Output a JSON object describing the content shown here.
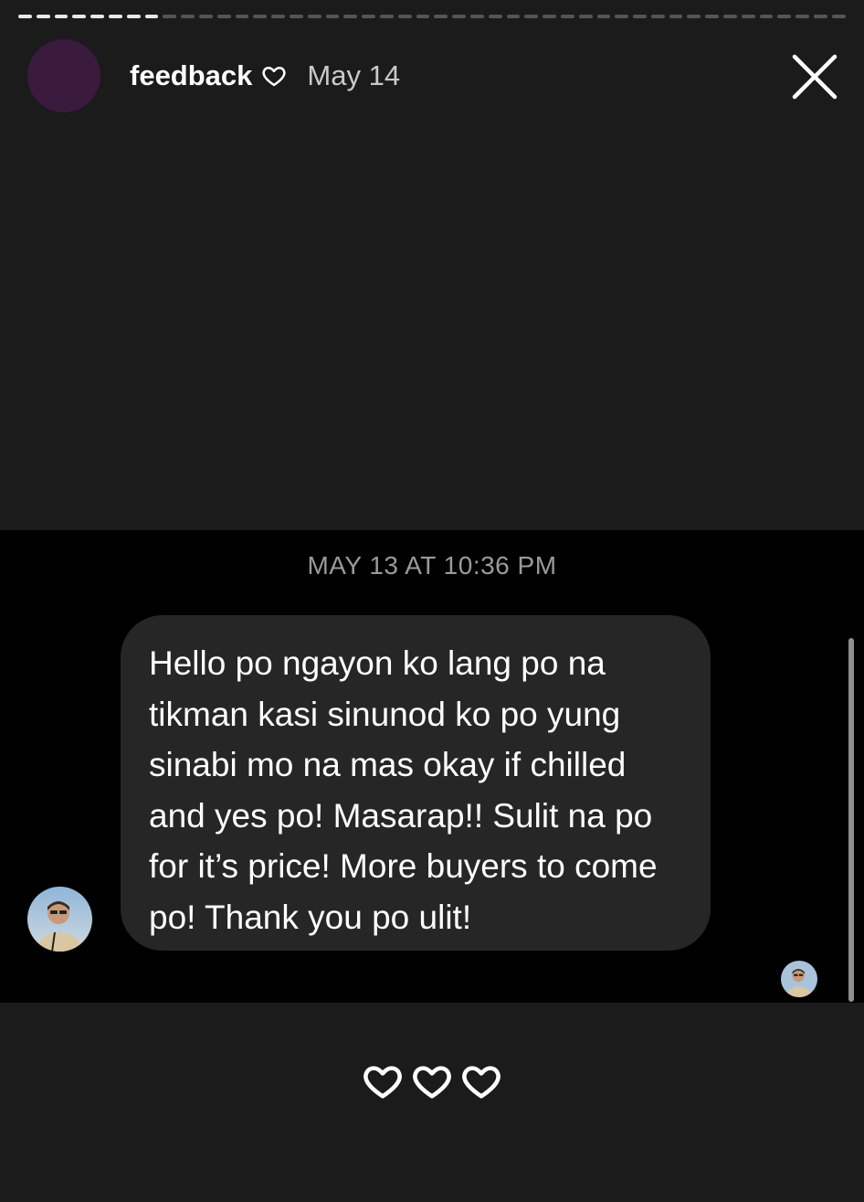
{
  "progress": {
    "total": 46,
    "completed": 8
  },
  "story": {
    "username": "feedback",
    "date": "May 14",
    "icons": {
      "heart": "heart-outline-icon",
      "close": "close-icon"
    }
  },
  "chat": {
    "timestamp": "MAY 13 AT 10:36 PM",
    "message": "Hello po ngayon ko lang po na tikman kasi sinunod ko po yung sinabi mo na mas okay if chilled and yes po! Masarap!! Sulit na po for it’s price! More buyers to come po! Thank you po ulit!"
  },
  "reactions": {
    "count": 3,
    "icon": "heart-outline-icon"
  },
  "colors": {
    "background": "#1b1b1b",
    "chat_background": "#000000",
    "bubble": "#262626",
    "story_avatar": "#3a1a3d"
  }
}
